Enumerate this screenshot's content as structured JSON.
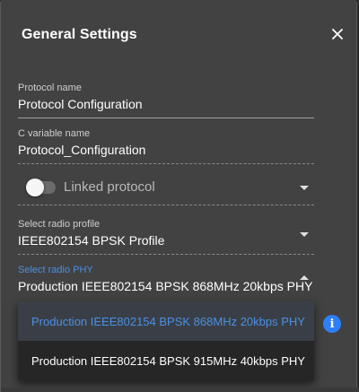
{
  "dialog": {
    "title": "General Settings",
    "close_icon": "close-icon"
  },
  "fields": {
    "protocol_name": {
      "label": "Protocol name",
      "value": "Protocol Configuration"
    },
    "c_variable_name": {
      "label": "C variable name",
      "value": "Protocol_Configuration"
    },
    "linked_protocol": {
      "label": "Linked protocol",
      "enabled": false
    },
    "radio_profile": {
      "label": "Select radio profile",
      "value": "IEEE802154 BPSK Profile"
    },
    "radio_phy": {
      "label": "Select radio PHY",
      "value": "Production IEEE802154 BPSK 868MHz 20kbps PHY",
      "options": [
        "Production IEEE802154 BPSK 868MHz 20kbps PHY",
        "Production IEEE802154 BPSK 915MHz 40kbps PHY"
      ],
      "selected_index": 0
    }
  },
  "colors": {
    "background": "#424242",
    "accent": "#4a90e2",
    "info": "#2d7ff9",
    "text": "#ffffff"
  },
  "info_icon": "info-icon"
}
